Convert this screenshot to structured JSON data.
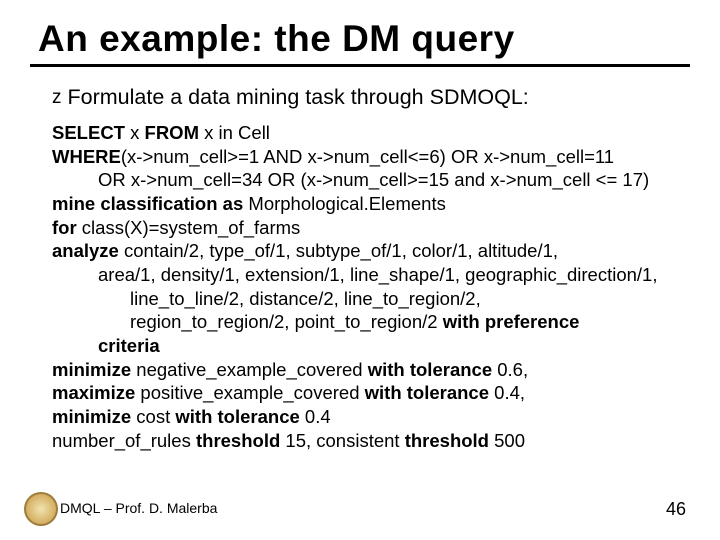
{
  "title": "An example: the DM query",
  "bullet": {
    "marker": "z",
    "text": "Formulate a data mining task through SDMOQL:"
  },
  "code": {
    "l1a": "SELECT",
    "l1b": " x ",
    "l1c": "FROM",
    "l1d": " x in Cell",
    "l2a": "WHERE",
    "l2b": "(x->num_cell>=1 AND x->num_cell<=6) OR x->num_cell=11",
    "l3": "OR x->num_cell=34 OR (x->num_cell>=15 and x->num_cell <= 17)",
    "l4a": "mine classification as",
    "l4b": " Morphological.Elements",
    "l5a": "for",
    "l5b": " class(X)=system_of_farms",
    "l6a": "analyze",
    "l6b": " contain/2, type_of/1, subtype_of/1, color/1,    altitude/1,",
    "l7": "area/1, density/1, extension/1, line_shape/1, geographic_direction/1,",
    "l8": "line_to_line/2, distance/2, line_to_region/2,",
    "l9a": "region_to_region/2, point_to_region/2      ",
    "l9b": "with preference",
    "l10": "criteria",
    "l11a": "minimize",
    "l11b": " negative_example_covered ",
    "l11c": "with tolerance",
    "l11d": " 0.6,",
    "l12a": "maximize",
    "l12b": " positive_example_covered ",
    "l12c": "with tolerance",
    "l12d": " 0.4,",
    "l13a": "minimize",
    "l13b": " cost ",
    "l13c": "with tolerance",
    "l13d": " 0.4",
    "l14a": "number_of_rules ",
    "l14b": "threshold",
    "l14c": " 15, consistent ",
    "l14d": "threshold",
    "l14e": " 500"
  },
  "footer": "DMQL – Prof. D. Malerba",
  "page_number": "46"
}
